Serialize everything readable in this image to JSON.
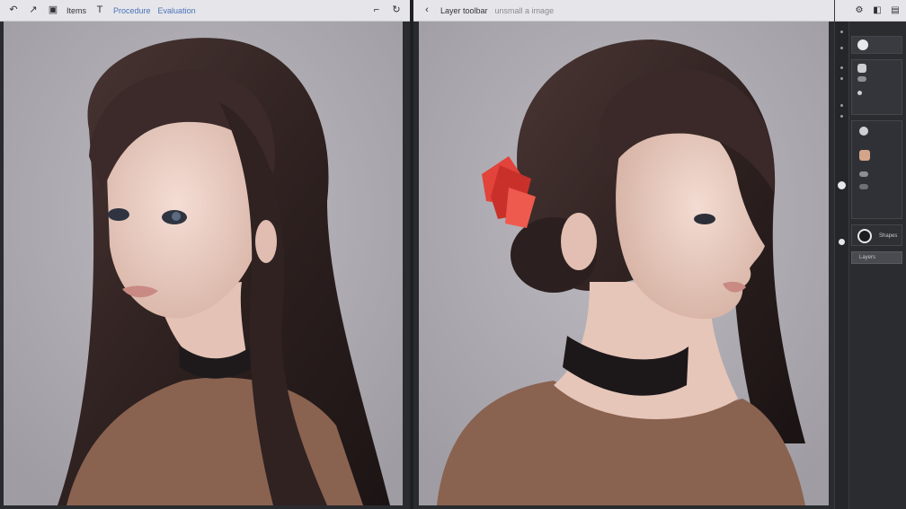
{
  "left_window": {
    "toolbar": {
      "undo_icon": "undo-arrow-icon",
      "tool_icon": "pen-tool-icon",
      "file_icon": "file-icon",
      "item1": "Items",
      "text_icon": "text-tool-icon",
      "item2": "Procedure",
      "item3": "Evaluation",
      "right_icon1": "crop-icon",
      "right_icon2": "refresh-icon"
    }
  },
  "right_window": {
    "toolbar": {
      "back_icon": "chevron-left-icon",
      "item1": "Layer toolbar",
      "item2": "unsmall a image"
    }
  },
  "side_panel": {
    "top_icons": [
      "settings-icon",
      "paint-bucket-icon",
      "stack-icon"
    ],
    "label_layer": "Shapes",
    "label_field": "Layers",
    "colors": {
      "skin": "#d4a58a",
      "dark": "#1d1d20",
      "light": "#e8e8ec"
    }
  },
  "colors": {
    "hair": "#3a2a28",
    "sweater": "#8a6250",
    "flower": "#e2433a",
    "background": "#aaa8ae"
  }
}
